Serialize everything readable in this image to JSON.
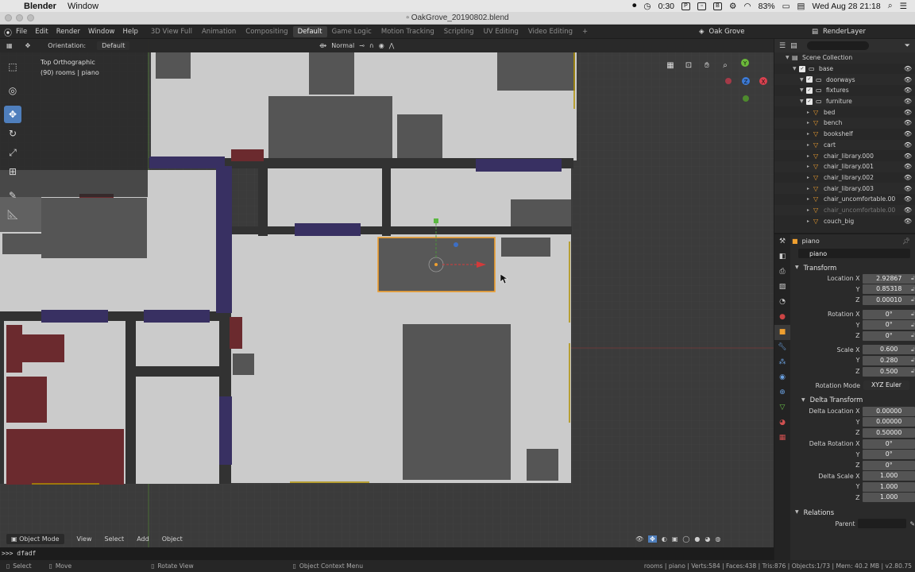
{
  "macbar": {
    "app_name": "Blender",
    "menu": "Window",
    "clock_text": "0:30",
    "battery": "83%",
    "datetime": "Wed Aug 28  21:18"
  },
  "window_title": "OakGrove_20190802.blend",
  "topbar": {
    "menus": [
      "File",
      "Edit",
      "Render",
      "Window",
      "Help"
    ],
    "workspaces": [
      "3D View Full",
      "Animation",
      "Compositing",
      "Default",
      "Game Logic",
      "Motion Tracking",
      "Scripting",
      "UV Editing",
      "Video Editing"
    ],
    "active_workspace": "Default",
    "add_tab": "+",
    "scene": "Oak Grove",
    "view_layer": "RenderLayer"
  },
  "viewport": {
    "orientation_label": "Orientation:",
    "orientation_value": "Default",
    "pivot_value": "Normal",
    "view_name": "Top Orthographic",
    "collection_info": "(90) rooms | piano",
    "axis_x": "X",
    "axis_y": "Y",
    "axis_z": "Z",
    "mode": "Object Mode",
    "footer_menus": [
      "View",
      "Select",
      "Add",
      "Object"
    ]
  },
  "console_line": ">>> dfadf",
  "statusbar": {
    "select": "Select",
    "move": "Move",
    "rotate_view": "Rotate View",
    "context_menu": "Object Context Menu",
    "stats": "rooms | piano | Verts:584 | Faces:438 | Tris:876 | Objects:1/73 | Mem: 40.2 MB | v2.80.75"
  },
  "outliner": {
    "rows": [
      {
        "label": "Scene Collection",
        "indent": 0,
        "type": "scene"
      },
      {
        "label": "base",
        "indent": 1,
        "type": "collection"
      },
      {
        "label": "doorways",
        "indent": 2,
        "type": "collection"
      },
      {
        "label": "fixtures",
        "indent": 2,
        "type": "collection"
      },
      {
        "label": "furniture",
        "indent": 2,
        "type": "collection"
      },
      {
        "label": "bed",
        "indent": 3,
        "type": "object"
      },
      {
        "label": "bench",
        "indent": 3,
        "type": "object"
      },
      {
        "label": "bookshelf",
        "indent": 3,
        "type": "object"
      },
      {
        "label": "cart",
        "indent": 3,
        "type": "object"
      },
      {
        "label": "chair_library.000",
        "indent": 3,
        "type": "object"
      },
      {
        "label": "chair_library.001",
        "indent": 3,
        "type": "object"
      },
      {
        "label": "chair_library.002",
        "indent": 3,
        "type": "object"
      },
      {
        "label": "chair_library.003",
        "indent": 3,
        "type": "object"
      },
      {
        "label": "chair_uncomfortable.00",
        "indent": 3,
        "type": "object"
      },
      {
        "label": "chair_uncomfortable.00",
        "indent": 3,
        "type": "object-faded"
      },
      {
        "label": "couch_big",
        "indent": 3,
        "type": "object"
      }
    ]
  },
  "properties": {
    "header_object": "piano",
    "object_name": "piano",
    "transform": {
      "title": "Transform",
      "location_label": "Location X",
      "location": [
        "2.92867",
        "0.85318",
        "0.00010"
      ],
      "rotation_label": "Rotation X",
      "rotation": [
        "0°",
        "0°",
        "0°"
      ],
      "scale_label": "Scale X",
      "scale": [
        "0.600",
        "0.280",
        "0.500"
      ],
      "rotation_mode_label": "Rotation Mode",
      "rotation_mode": "XYZ Euler"
    },
    "delta": {
      "title": "Delta Transform",
      "location_label": "Delta Location X",
      "location": [
        "0.00000",
        "0.00000",
        "0.50000"
      ],
      "rotation_label": "Delta Rotation X",
      "rotation": [
        "0°",
        "0°",
        "0°"
      ],
      "scale_label": "Delta Scale X",
      "scale": [
        "1.000",
        "1.000",
        "1.000"
      ]
    },
    "relations": {
      "title": "Relations",
      "parent_label": "Parent"
    },
    "y_label": "Y",
    "z_label": "Z"
  },
  "colors": {
    "accent_blue": "#4f7fbd",
    "selection_orange": "#f0a030",
    "floor": "#cbcbcb",
    "wall": "#323232",
    "doorway": "#383062",
    "fixture": "#6b2a2e",
    "furniture": "#555555"
  }
}
